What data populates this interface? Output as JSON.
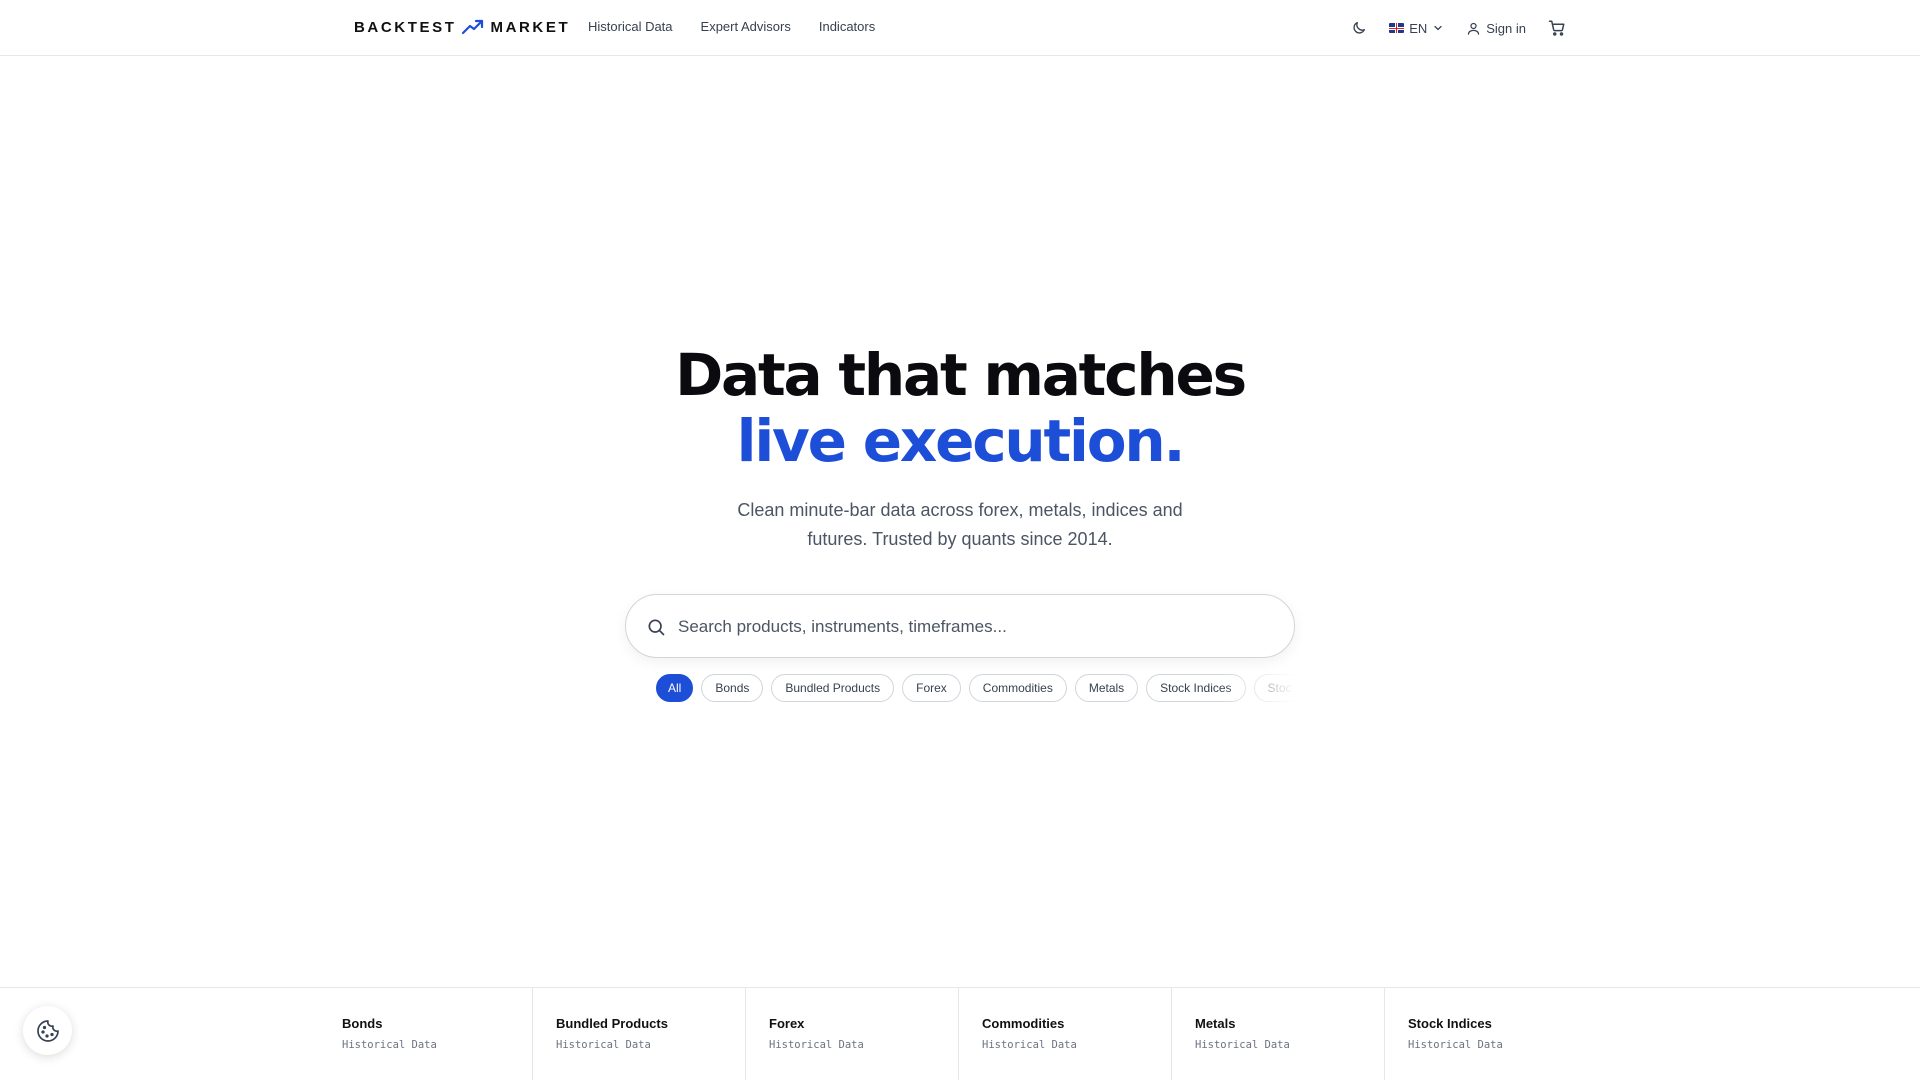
{
  "brand": {
    "left": "BACKTEST",
    "right": "MARKET",
    "accent": "#1d4ed8"
  },
  "nav": {
    "items": [
      "Historical Data",
      "Expert Advisors",
      "Indicators"
    ]
  },
  "header_tools": {
    "theme_icon": "moon-icon",
    "language": "EN",
    "sign_in": "Sign in",
    "cart_icon": "cart-icon"
  },
  "hero": {
    "title_line1": "Data that matches",
    "title_line2": "live execution.",
    "subtitle": "Clean minute-bar data across forex, metals, indices and futures. Trusted by quants since 2014."
  },
  "search": {
    "placeholder": "Search products, instruments, timeframes..."
  },
  "chips": [
    "All",
    "Bonds",
    "Bundled Products",
    "Forex",
    "Commodities",
    "Metals",
    "Stock Indices",
    "Stoc"
  ],
  "active_chip": "All",
  "categories": [
    {
      "name": "Bonds",
      "sub": "Historical Data"
    },
    {
      "name": "Bundled Products",
      "sub": "Historical Data"
    },
    {
      "name": "Forex",
      "sub": "Historical Data"
    },
    {
      "name": "Commodities",
      "sub": "Historical Data"
    },
    {
      "name": "Metals",
      "sub": "Historical Data"
    },
    {
      "name": "Stock Indices",
      "sub": "Historical Data"
    }
  ],
  "cookie_icon": "cookie-icon"
}
